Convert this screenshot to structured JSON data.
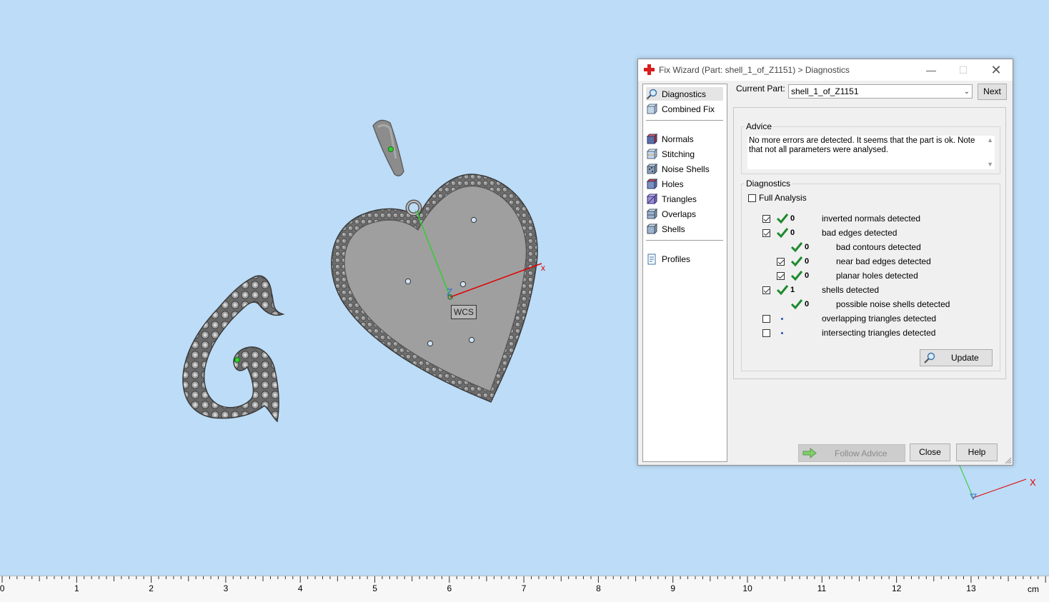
{
  "window": {
    "title": "Fix Wizard (Part: shell_1_of_Z1151) > Diagnostics"
  },
  "nav": {
    "items": [
      {
        "label": "Diagnostics",
        "icon": "diagnostics-icon"
      },
      {
        "label": "Combined Fix",
        "icon": "combined-fix-icon"
      },
      {
        "label": "Normals",
        "icon": "normals-icon"
      },
      {
        "label": "Stitching",
        "icon": "stitching-icon"
      },
      {
        "label": "Noise Shells",
        "icon": "noise-shells-icon"
      },
      {
        "label": "Holes",
        "icon": "holes-icon"
      },
      {
        "label": "Triangles",
        "icon": "triangles-icon"
      },
      {
        "label": "Overlaps",
        "icon": "overlaps-icon"
      },
      {
        "label": "Shells",
        "icon": "shells-icon"
      },
      {
        "label": "Profiles",
        "icon": "profiles-icon"
      }
    ],
    "selected": "Diagnostics"
  },
  "current_part": {
    "label": "Current Part:",
    "value": "shell_1_of_Z1151",
    "next_label": "Next"
  },
  "advice": {
    "title": "Advice",
    "text": "No more errors are detected. It seems that the part is ok. Note that not all parameters were analysed."
  },
  "diagnostics": {
    "title": "Diagnostics",
    "full_analysis_label": "Full Analysis",
    "rows": [
      {
        "checkbox": true,
        "checked": true,
        "status": "ok",
        "count": "0",
        "label": "inverted normals detected"
      },
      {
        "checkbox": true,
        "checked": true,
        "status": "ok",
        "count": "0",
        "label": "bad edges detected"
      },
      {
        "checkbox": false,
        "checked": false,
        "status": "ok",
        "count": "0",
        "label": "bad contours detected"
      },
      {
        "checkbox": true,
        "checked": true,
        "status": "ok",
        "count": "0",
        "label": "near bad edges detected"
      },
      {
        "checkbox": true,
        "checked": true,
        "status": "ok",
        "count": "0",
        "label": "planar holes detected"
      },
      {
        "checkbox": true,
        "checked": true,
        "status": "ok",
        "count": "1",
        "label": "shells detected"
      },
      {
        "checkbox": false,
        "checked": false,
        "status": "ok",
        "count": "0",
        "label": "possible noise shells detected"
      },
      {
        "checkbox": true,
        "checked": false,
        "status": "unknown",
        "count": "",
        "label": "overlapping triangles detected"
      },
      {
        "checkbox": true,
        "checked": false,
        "status": "unknown",
        "count": "",
        "label": "intersecting triangles detected"
      }
    ],
    "update_label": "Update"
  },
  "buttons": {
    "follow_advice": "Follow Advice",
    "close": "Close",
    "help": "Help"
  },
  "viewport": {
    "wcs_label": "WCS",
    "axis_x_label": "x",
    "corner_axis_x_label": "X"
  },
  "ruler": {
    "labels": [
      "0",
      "1",
      "2",
      "3",
      "4",
      "5",
      "6",
      "7",
      "8",
      "9",
      "10",
      "11",
      "12",
      "13"
    ],
    "unit": "cm"
  },
  "colors": {
    "background": "#bcdcf7",
    "model_gray": "#8e8e8e",
    "check_green": "#1e8a2e",
    "axis_red": "#e00000",
    "axis_green": "#33cc33",
    "title_cross_red": "#d81d1d"
  }
}
